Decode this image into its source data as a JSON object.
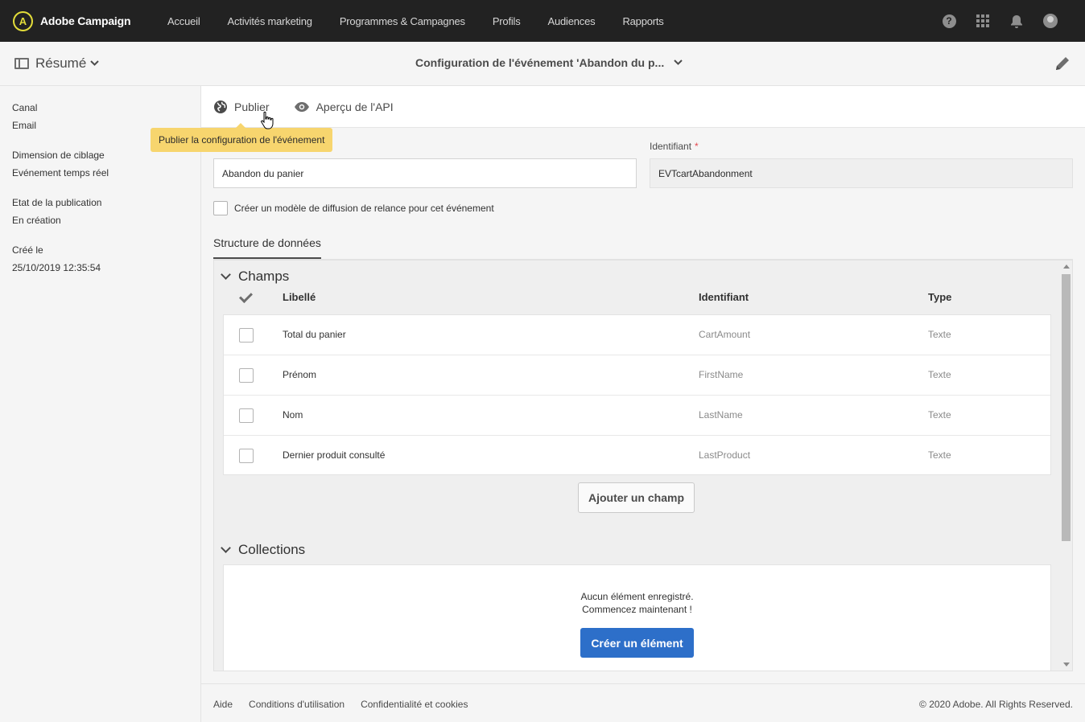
{
  "topbar": {
    "brand_initial": "A",
    "brand_name": "Adobe Campaign",
    "nav": [
      "Accueil",
      "Activités marketing",
      "Programmes & Campagnes",
      "Profils",
      "Audiences",
      "Rapports"
    ],
    "help_glyph": "?",
    "icons": [
      "help-icon",
      "apps-grid-icon",
      "bell-icon",
      "user-avatar-icon"
    ]
  },
  "subbar": {
    "summary_label": "Résumé",
    "page_title": "Configuration de l'événement 'Abandon du p...",
    "icons": [
      "panel-icon",
      "chevron-down-icon",
      "pencil-icon"
    ]
  },
  "sidebar": {
    "items": [
      {
        "label": "Canal",
        "value": "Email"
      },
      {
        "label": "Dimension de ciblage",
        "value": "Evénement temps réel"
      },
      {
        "label": "Etat de la publication",
        "value": "En création"
      },
      {
        "label": "Créé le",
        "value": "25/10/2019 12:35:54"
      }
    ]
  },
  "actions": {
    "publish": "Publier",
    "api_preview": "Aperçu de l'API",
    "tooltip": "Publier la configuration de l'événement"
  },
  "form": {
    "label_value": "Abandon du panier",
    "id_label": "Identifiant",
    "id_required_mark": "*",
    "id_value": "EVTcartAbandonment",
    "reminder_checkbox": "Créer un modèle de diffusion de relance pour cet événement",
    "reminder_checked": false
  },
  "structure": {
    "tab": "Structure de données",
    "fields_title": "Champs",
    "columns": [
      "Libellé",
      "Identifiant",
      "Type"
    ],
    "rows": [
      {
        "label": "Total du panier",
        "id": "CartAmount",
        "type": "Texte"
      },
      {
        "label": "Prénom",
        "id": "FirstName",
        "type": "Texte"
      },
      {
        "label": "Nom",
        "id": "LastName",
        "type": "Texte"
      },
      {
        "label": "Dernier produit consulté",
        "id": "LastProduct",
        "type": "Texte"
      }
    ],
    "add_field": "Ajouter un champ",
    "collections_title": "Collections",
    "empty_line1": "Aucun élément enregistré.",
    "empty_line2": "Commencez maintenant !",
    "create_element": "Créer un élément"
  },
  "footer": {
    "links": [
      "Aide",
      "Conditions d'utilisation",
      "Confidentialité et cookies"
    ],
    "copyright": "© 2020 Adobe. All Rights Reserved."
  },
  "colors": {
    "topbar_bg": "#222222",
    "brand_accent": "#e3dd3a",
    "tooltip_bg": "#f7d56e",
    "primary_button": "#2d6fc9",
    "required": "#e34850"
  }
}
